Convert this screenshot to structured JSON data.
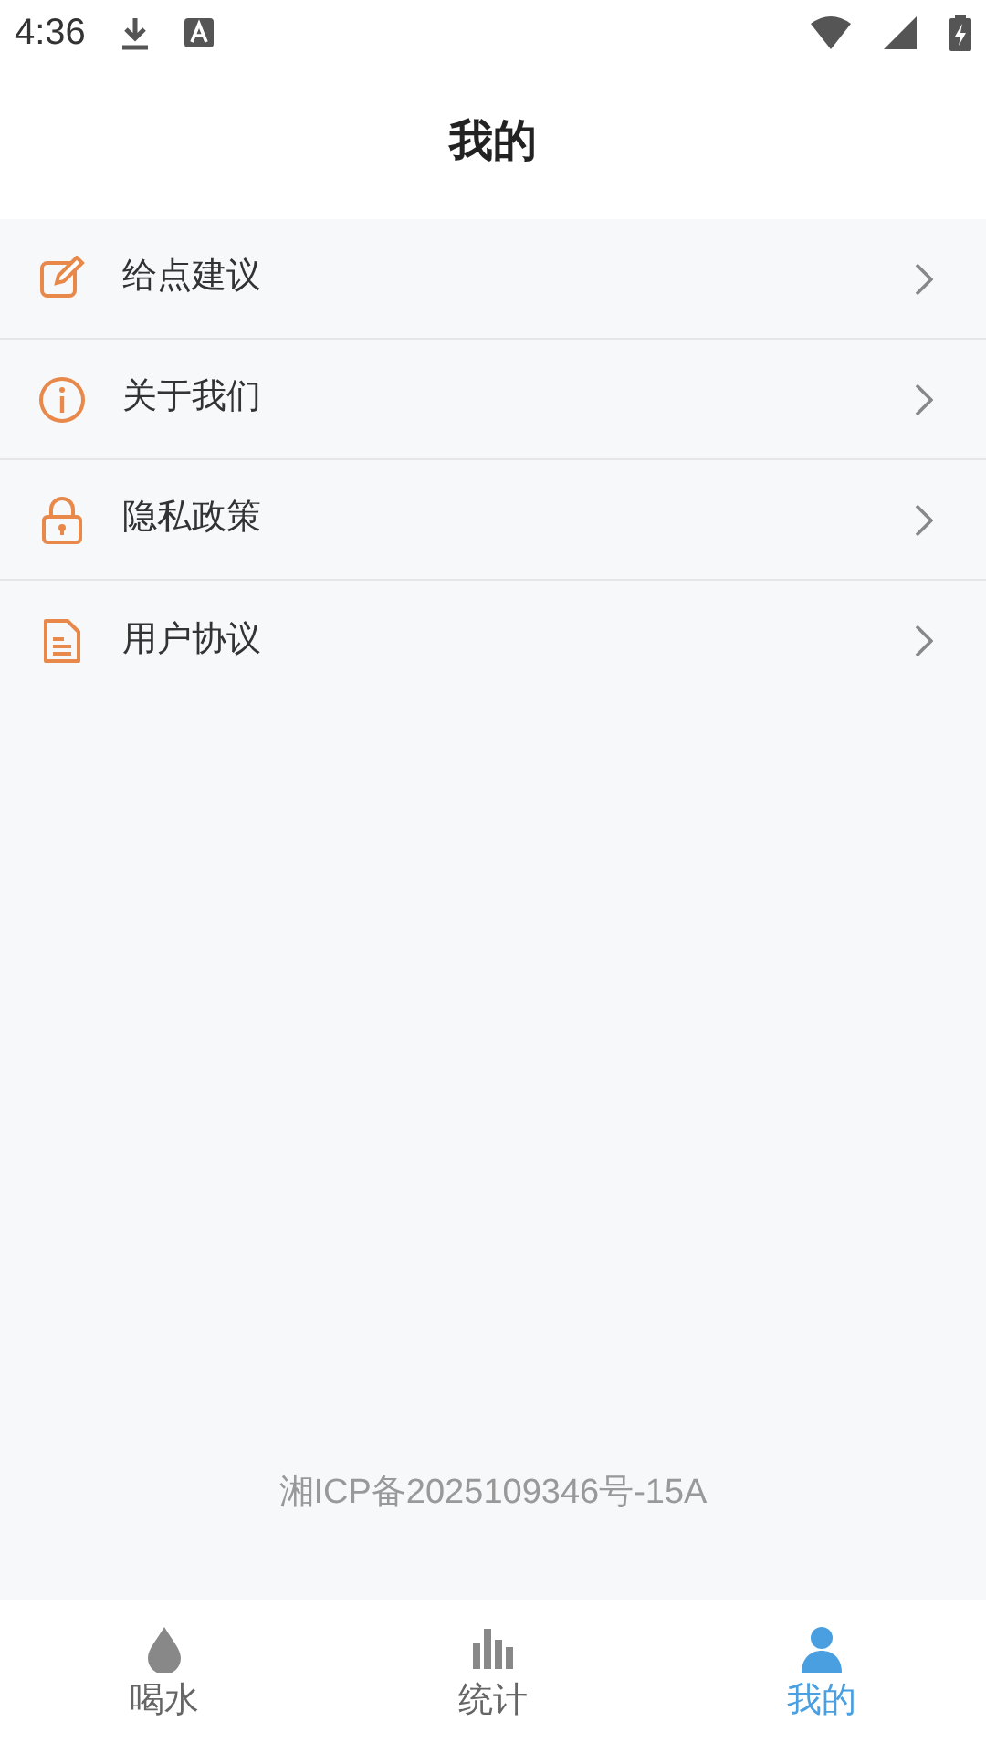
{
  "status_bar": {
    "time": "4:36"
  },
  "header": {
    "title": "我的"
  },
  "menu": [
    {
      "kind": "edit",
      "label": "给点建议"
    },
    {
      "kind": "info",
      "label": "关于我们"
    },
    {
      "kind": "lock",
      "label": "隐私政策"
    },
    {
      "kind": "document",
      "label": "用户协议"
    }
  ],
  "footer": {
    "text": "湘ICP备2025109346号-15A"
  },
  "tabs": [
    {
      "kind": "drop",
      "label": "喝水",
      "selected": false
    },
    {
      "kind": "chart",
      "label": "统计",
      "selected": false
    },
    {
      "kind": "person",
      "label": "我的",
      "selected": true
    }
  ]
}
